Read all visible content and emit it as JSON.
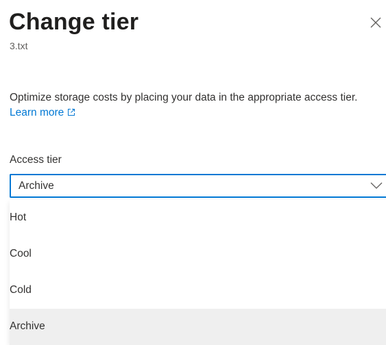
{
  "panel": {
    "title": "Change tier",
    "subtitle": "3.txt",
    "description": "Optimize storage costs by placing your data in the appropriate access tier.",
    "learn_more_label": "Learn more",
    "close_icon": "close-icon",
    "external_link_icon": "external-link-icon"
  },
  "access_tier": {
    "label": "Access tier",
    "selected_value": "Archive",
    "options": [
      {
        "label": "Hot"
      },
      {
        "label": "Cool"
      },
      {
        "label": "Cold"
      },
      {
        "label": "Archive"
      }
    ],
    "selected_index": 3
  },
  "colors": {
    "accent": "#0078d4",
    "selected_option_bg": "#efefef"
  }
}
